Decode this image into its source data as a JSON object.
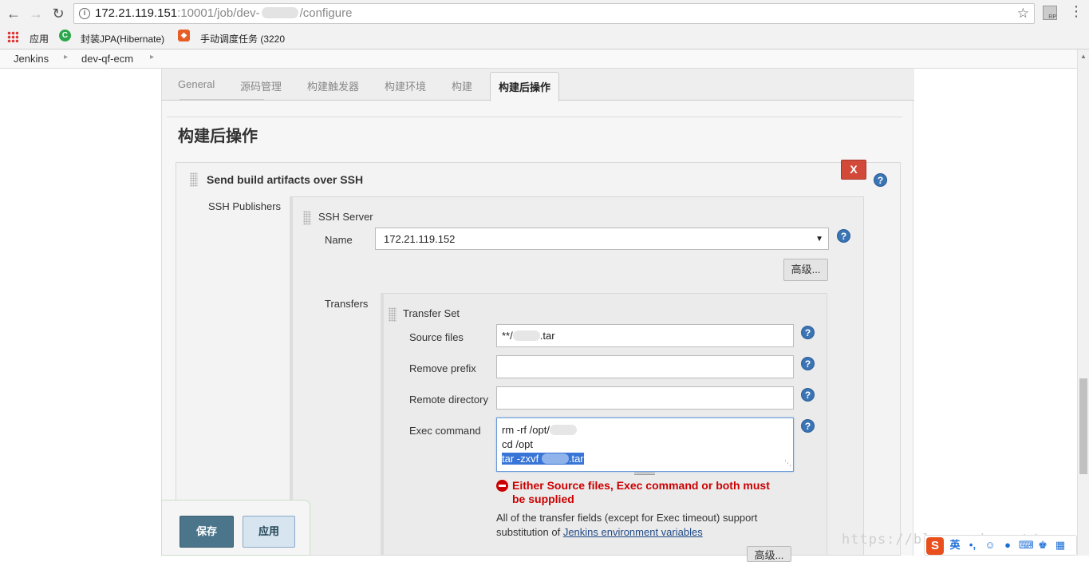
{
  "browser": {
    "url_host": "172.21.119.151",
    "url_rest": ":10001/job/dev-",
    "url_tail": "/configure",
    "bookmarks": [
      {
        "label": "应用"
      },
      {
        "label": "封装JPA(Hibernate)"
      },
      {
        "label": "手动调度任务 (3220"
      }
    ]
  },
  "breadcrumb": [
    "Jenkins",
    "dev-qf-ecm"
  ],
  "tabs": [
    {
      "label": "General"
    },
    {
      "label": "源码管理"
    },
    {
      "label": "构建触发器"
    },
    {
      "label": "构建环境"
    },
    {
      "label": "构建"
    },
    {
      "label": "构建后操作",
      "active": true
    }
  ],
  "section_title": "构建后操作",
  "publisher": {
    "title": "Send build artifacts over SSH",
    "delete_label": "X",
    "ssh_publishers_label": "SSH Publishers",
    "ssh_server_label": "SSH Server",
    "name_label": "Name",
    "name_value": "172.21.119.152",
    "advanced_label": "高级...",
    "transfers_label": "Transfers",
    "transfer_set_label": "Transfer Set",
    "source_files_label": "Source files",
    "source_files_prefix": "**/",
    "source_files_suffix": ".tar",
    "remove_prefix_label": "Remove prefix",
    "remove_prefix_value": "",
    "remote_directory_label": "Remote directory",
    "remote_directory_value": "",
    "exec_command_label": "Exec command",
    "exec_line1": "rm -rf /opt/",
    "exec_line2": "cd /opt",
    "exec_line3a": "tar -zxvf ",
    "exec_line3b": ".tar",
    "error_text": "Either Source files, Exec command or both must be supplied",
    "note_text": "All of the transfer fields (except for Exec timeout) support substitution of ",
    "note_link": "Jenkins environment variables",
    "advanced2_label": "高级..."
  },
  "actions": {
    "save": "保存",
    "apply": "应用"
  },
  "watermark": "https://blog.csdn.net/",
  "ime": {
    "s": "S",
    "lang": "英"
  },
  "colors": {
    "save": "#4b758b",
    "delete": "#d24939",
    "error": "#cc0000",
    "help": "#3a74b5"
  }
}
